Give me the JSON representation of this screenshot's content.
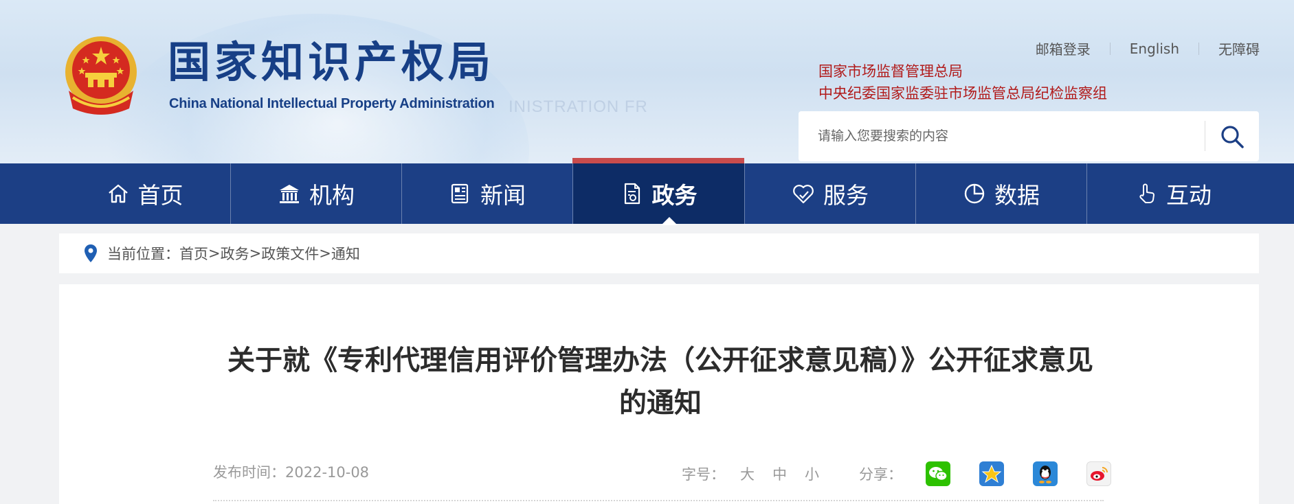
{
  "header": {
    "logo_cn": "国家知识产权局",
    "logo_en": "China National Intellectual Property Administration",
    "ghost_text": "INISTRATION FR",
    "top_links": [
      "邮箱登录",
      "English",
      "无障碍"
    ],
    "org_links": [
      "国家市场监督管理总局",
      "中央纪委国家监委驻市场监管总局纪检监察组"
    ],
    "search": {
      "placeholder": "请输入您要搜索的内容",
      "value": ""
    }
  },
  "nav": {
    "items": [
      {
        "label": "首页",
        "icon": "home-icon"
      },
      {
        "label": "机构",
        "icon": "institution-icon"
      },
      {
        "label": "新闻",
        "icon": "news-icon"
      },
      {
        "label": "政务",
        "icon": "document-icon",
        "active": true
      },
      {
        "label": "服务",
        "icon": "service-icon"
      },
      {
        "label": "数据",
        "icon": "pie-chart-icon"
      },
      {
        "label": "互动",
        "icon": "hand-pointer-icon"
      }
    ]
  },
  "breadcrumb": {
    "label": "当前位置：",
    "items": [
      "首页",
      "政务",
      "政策文件",
      "通知"
    ],
    "separator": ">"
  },
  "article": {
    "title": "关于就《专利代理信用评价管理办法（公开征求意见稿）》公开征求意见的通知",
    "publish_label": "发布时间：",
    "publish_date": "2022-10-08",
    "font_size_label": "字号：",
    "font_sizes": [
      "大",
      "中",
      "小"
    ],
    "share_label": "分享：",
    "share_targets": [
      "wechat-icon",
      "qzone-icon",
      "qq-icon",
      "weibo-icon"
    ]
  },
  "colors": {
    "nav_bg": "#1c3f85",
    "nav_active_bg": "#0d2c66",
    "nav_active_bar": "#c94c4c",
    "logo_blue": "#173f86",
    "org_red": "#b11a1a"
  }
}
